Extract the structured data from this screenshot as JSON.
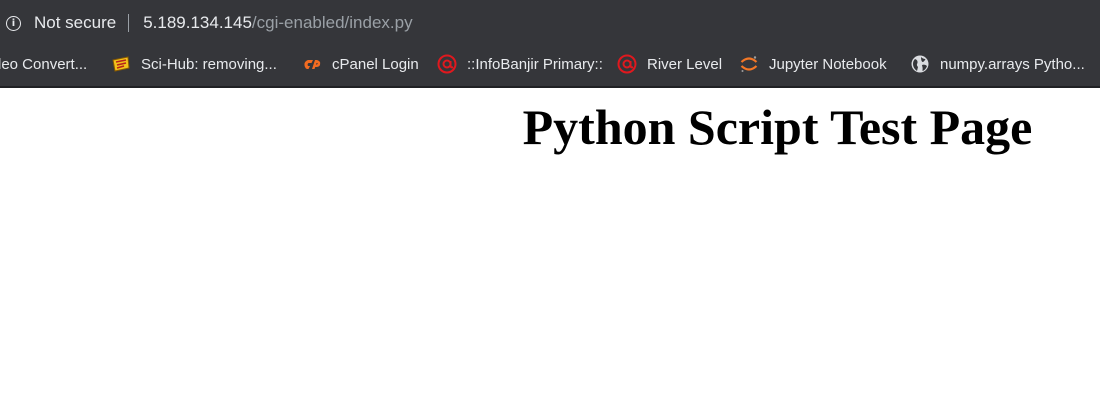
{
  "address_bar": {
    "security_label": "Not secure",
    "url_host": "5.189.134.145",
    "url_path": "/cgi-enabled/index.py"
  },
  "bookmarks": [
    {
      "label": "leo Convert...",
      "icon": "none"
    },
    {
      "label": "Sci-Hub: removing...",
      "icon": "scihub-icon"
    },
    {
      "label": "cPanel Login",
      "icon": "cpanel-icon"
    },
    {
      "label": "::InfoBanjir Primary::",
      "icon": "infobanjir-icon"
    },
    {
      "label": "River Level",
      "icon": "infobanjir-icon"
    },
    {
      "label": "Jupyter Notebook",
      "icon": "jupyter-icon"
    },
    {
      "label": "numpy.arrays Pytho...",
      "icon": "globe-icon"
    }
  ],
  "page": {
    "title": "Python Script Test Page"
  },
  "colors": {
    "toolbar_bg": "#35363a",
    "toolbar_text": "#e8eaed",
    "url_path_text": "#9aa0a6",
    "cpanel_orange": "#f26b21",
    "infobanjir_red": "#e0181e",
    "jupyter_orange": "#f37726"
  }
}
